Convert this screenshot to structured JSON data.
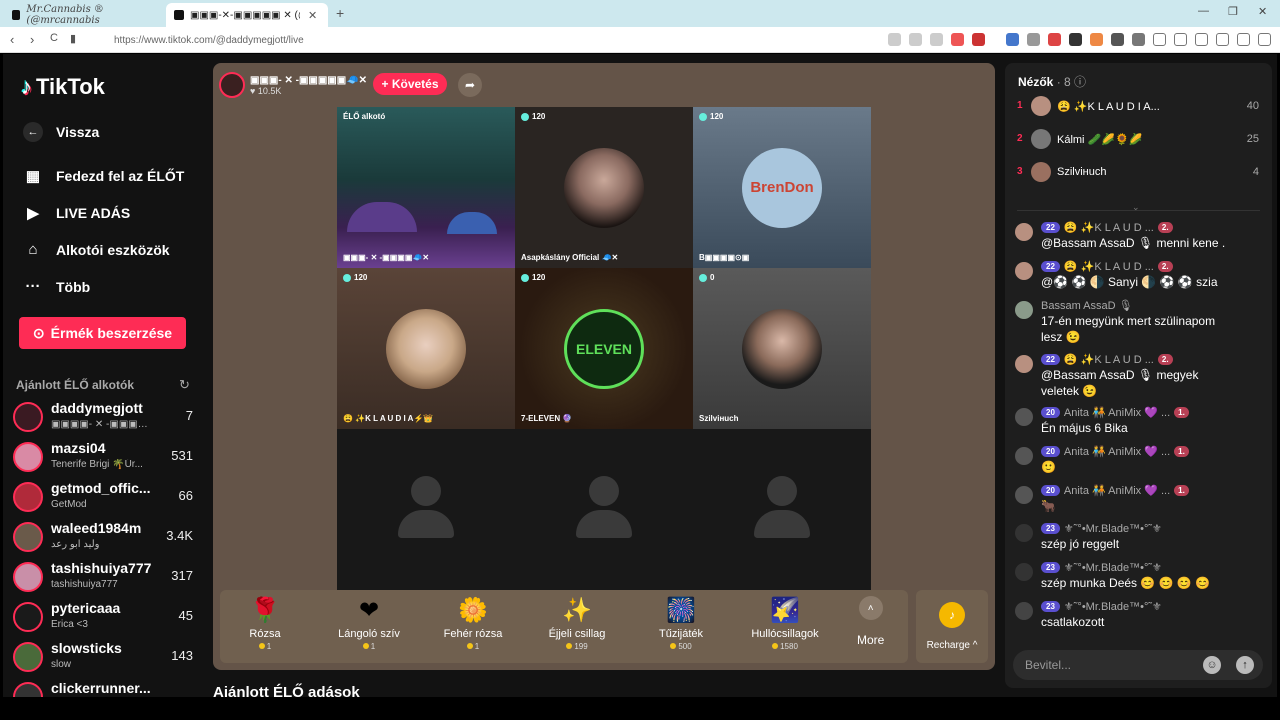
{
  "browser": {
    "tab1_title": "Mr.Cannabis ® (@mrcannabis",
    "tab2_title": "▣▣▣-✕-▣▣▣▣▣ ✕ (@da",
    "new_tab": "+",
    "url": "https://www.tiktok.com/@daddymegjott/live",
    "back": "‹",
    "forward": "›",
    "reload": "C",
    "minimize": "—",
    "restore": "❐",
    "close": "✕"
  },
  "sidebar": {
    "logo": "TikTok",
    "back_label": "Vissza",
    "nav": [
      {
        "icon": "▦",
        "label": "Fedezd fel az ÉLŐT"
      },
      {
        "icon": "▶",
        "label": "LIVE ADÁS"
      },
      {
        "icon": "⌂",
        "label": "Alkotói eszközök"
      },
      {
        "icon": "···",
        "label": "Több"
      }
    ],
    "coin_button": "Érmék beszerzése",
    "recommended_title": "Ajánlott ÉLŐ alkotók",
    "creators": [
      {
        "name": "daddymegjott",
        "sub": "▣▣▣▣- ✕ -▣▣▣▣▣",
        "count": "7",
        "color": "#3a1a22"
      },
      {
        "name": "mazsi04",
        "sub": "Tenerife Brigi 🌴Úr...",
        "count": "531",
        "color": "#d98aa5"
      },
      {
        "name": "getmod_offic...",
        "sub": "GetMod",
        "count": "66",
        "color": "#b02a3a"
      },
      {
        "name": "waleed1984m",
        "sub": "وليد ابو رعد",
        "count": "3.4K",
        "color": "#6a5a4a"
      },
      {
        "name": "tashishuiya777",
        "sub": "tashishuiya777",
        "count": "317",
        "color": "#c98fa8"
      },
      {
        "name": "pytericaaa",
        "sub": "Erica  <3",
        "count": "45",
        "color": "#1a1a1a"
      },
      {
        "name": "slowsticks",
        "sub": "slow",
        "count": "143",
        "color": "#4a6a3a"
      },
      {
        "name": "clickerrunner...",
        "sub": "",
        "count": "",
        "color": "#333"
      }
    ]
  },
  "stream": {
    "host_name": "▣▣▣- ✕ -▣▣▣▣▣🧢✕",
    "host_likes": "♥ 10.5K",
    "follow_label": "+ Követés",
    "cells": [
      {
        "badge": "ÉLŐ alkotó",
        "label": "▣▣▣- ✕ -▣▣▣▣🧢✕",
        "bg": "forest"
      },
      {
        "badge": "120",
        "label": "Asapkáslány Official 🧢✕",
        "bg": "dark"
      },
      {
        "badge": "120",
        "label": "B▣▣▣▣⊙▣",
        "bg": "blue"
      },
      {
        "badge": "120",
        "label": "😩 ✨K L A U D I A⚡👑",
        "bg": "brown"
      },
      {
        "badge": "120",
        "label": "7-ELEVEN 🔮",
        "bg": "green"
      },
      {
        "badge": "0",
        "label": "Szilviнuch",
        "bg": "grey"
      }
    ],
    "brendon": "BrenDon",
    "eleven": "ELEVEN"
  },
  "gifts": [
    {
      "icon": "🌹",
      "name": "Rózsa",
      "price": "1"
    },
    {
      "icon": "❤",
      "name": "Lángoló szív",
      "price": "1"
    },
    {
      "icon": "🌼",
      "name": "Fehér rózsa",
      "price": "1"
    },
    {
      "icon": "✨",
      "name": "Éjjeli csillag",
      "price": "199"
    },
    {
      "icon": "🎆",
      "name": "Tűzijáték",
      "price": "500"
    },
    {
      "icon": "🌠",
      "name": "Hullócsillagok",
      "price": "1580"
    }
  ],
  "more_label": "More",
  "recharge_label": "Recharge ^",
  "bottom_title": "Ajánlott ÉLŐ adások",
  "viewers": {
    "title": "Nézők",
    "count": "· 8",
    "list": [
      {
        "rank": "1",
        "name": "😩 ✨K L A U D I A...",
        "score": "40",
        "color": "#b89080"
      },
      {
        "rank": "2",
        "name": "Kálmi 🥒🌽🌻🌽",
        "score": "25",
        "color": "#777"
      },
      {
        "rank": "3",
        "name": "Szilviнuch",
        "score": "4",
        "color": "#9a7060"
      }
    ]
  },
  "chat": [
    {
      "lvl": "22",
      "user": "😩 ✨K L A U D ...",
      "badge": "2.",
      "text": "@Bassam AssaD 🎙 menni kene .",
      "color": "#b89080"
    },
    {
      "lvl": "22",
      "user": "😩 ✨K L A U D ...",
      "badge": "2.",
      "text": "@⚽ ⚽ 🌗 Sanyi 🌗 ⚽ ⚽ szia",
      "color": "#b89080"
    },
    {
      "lvl": "",
      "user": "Bassam AssaD 🎙",
      "badge": "",
      "text": "17-én megyünk mert szülinapom lesz 😉",
      "color": "#8a9a8a"
    },
    {
      "lvl": "22",
      "user": "😩 ✨K L A U D ...",
      "badge": "2.",
      "text": "@Bassam AssaD 🎙 megyek veletek 😉",
      "color": "#b89080"
    },
    {
      "lvl": "20",
      "user": "Anita 🧑‍🤝‍🧑 AniMix 💜 ...",
      "badge": "1.",
      "text": "Én május 6 Bika",
      "color": "#555"
    },
    {
      "lvl": "20",
      "user": "Anita 🧑‍🤝‍🧑 AniMix 💜 ...",
      "badge": "1.",
      "text": "🙂",
      "color": "#555"
    },
    {
      "lvl": "20",
      "user": "Anita 🧑‍🤝‍🧑 AniMix 💜 ...",
      "badge": "1.",
      "text": "🐂",
      "color": "#555"
    },
    {
      "lvl": "23",
      "user": "⚜˜°•Mr.Blade™•°˜⚜",
      "badge": "",
      "text": "szép jó reggelt",
      "color": "#333"
    },
    {
      "lvl": "23",
      "user": "⚜˜°•Mr.Blade™•°˜⚜",
      "badge": "",
      "text": "szép munka Deés 😊 😊 😊 😊",
      "color": "#333"
    },
    {
      "lvl": "23",
      "user": "⚜˜°•Mr.Blade™•°˜⚜",
      "badge": "",
      "text": "csatlakozott",
      "color": "#444"
    }
  ],
  "input_placeholder": "Bevitel...",
  "colors": {
    "accent": "#fe2c55",
    "panel": "#1e1e1e",
    "stage": "#645448"
  }
}
